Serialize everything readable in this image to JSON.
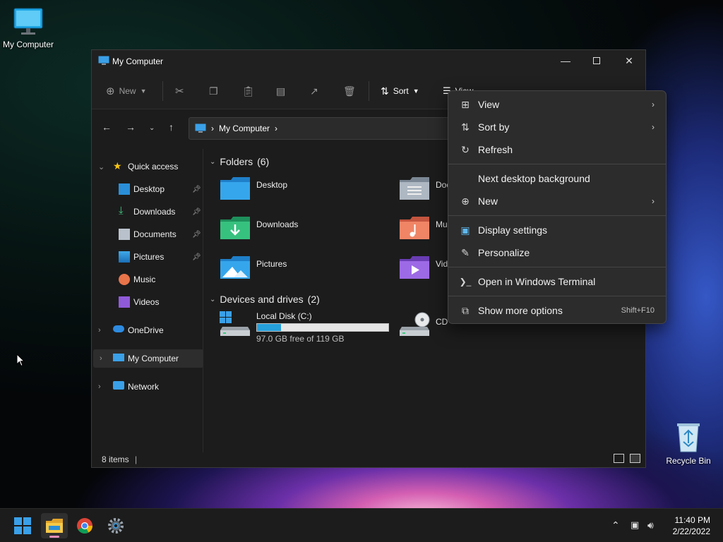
{
  "desktop": {
    "my_computer_label": "My Computer",
    "recycle_bin_label": "Recycle Bin"
  },
  "window": {
    "title": "My Computer",
    "toolbar": {
      "new_label": "New",
      "sort_label": "Sort",
      "view_label": "View"
    },
    "address": {
      "crumb": "My Computer"
    },
    "sidebar": {
      "quick_access": "Quick access",
      "items": [
        {
          "label": "Desktop",
          "pinned": true
        },
        {
          "label": "Downloads",
          "pinned": true
        },
        {
          "label": "Documents",
          "pinned": true
        },
        {
          "label": "Pictures",
          "pinned": true
        },
        {
          "label": "Music",
          "pinned": false
        },
        {
          "label": "Videos",
          "pinned": false
        }
      ],
      "onedrive": "OneDrive",
      "my_computer": "My Computer",
      "network": "Network"
    },
    "content": {
      "folders_header": "Folders",
      "folders_count": "(6)",
      "folders": [
        "Desktop",
        "Documents",
        "Downloads",
        "Music",
        "Pictures",
        "Videos"
      ],
      "folders_visible": [
        "Desktop",
        "Doc",
        "Downloads",
        "Mu",
        "Pictures",
        "Vid"
      ],
      "drives_header": "Devices and drives",
      "drives_count": "(2)",
      "drive_c_name": "Local Disk (C:)",
      "drive_c_free": "97.0 GB free of 119 GB",
      "drive_c_used_fraction": 0.185,
      "drive_d_name_visible": "CD"
    },
    "status": {
      "items_text": "8 items"
    }
  },
  "context_menu": {
    "items": [
      {
        "label": "View",
        "icon": "grid-icon",
        "submenu": true
      },
      {
        "label": "Sort by",
        "icon": "sort-icon",
        "submenu": true
      },
      {
        "label": "Refresh",
        "icon": "refresh-icon",
        "submenu": false
      },
      {
        "label": "Next desktop background",
        "icon": "",
        "submenu": false
      },
      {
        "label": "New",
        "icon": "plus-circle-icon",
        "submenu": true
      },
      {
        "label": "Display settings",
        "icon": "display-icon",
        "submenu": false
      },
      {
        "label": "Personalize",
        "icon": "brush-icon",
        "submenu": false
      },
      {
        "label": "Open in Windows Terminal",
        "icon": "terminal-icon",
        "submenu": false
      },
      {
        "label": "Show more options",
        "icon": "expand-icon",
        "shortcut": "Shift+F10"
      }
    ]
  },
  "taskbar": {
    "time": "11:40 PM",
    "date": "2/22/2022"
  },
  "colors": {
    "accent": "#3aa0e8",
    "window_bg": "#1c1c1c",
    "menu_bg": "#2c2c2c",
    "folder_blue": "#3aa0e8",
    "progress_fill": "#26a0da"
  }
}
